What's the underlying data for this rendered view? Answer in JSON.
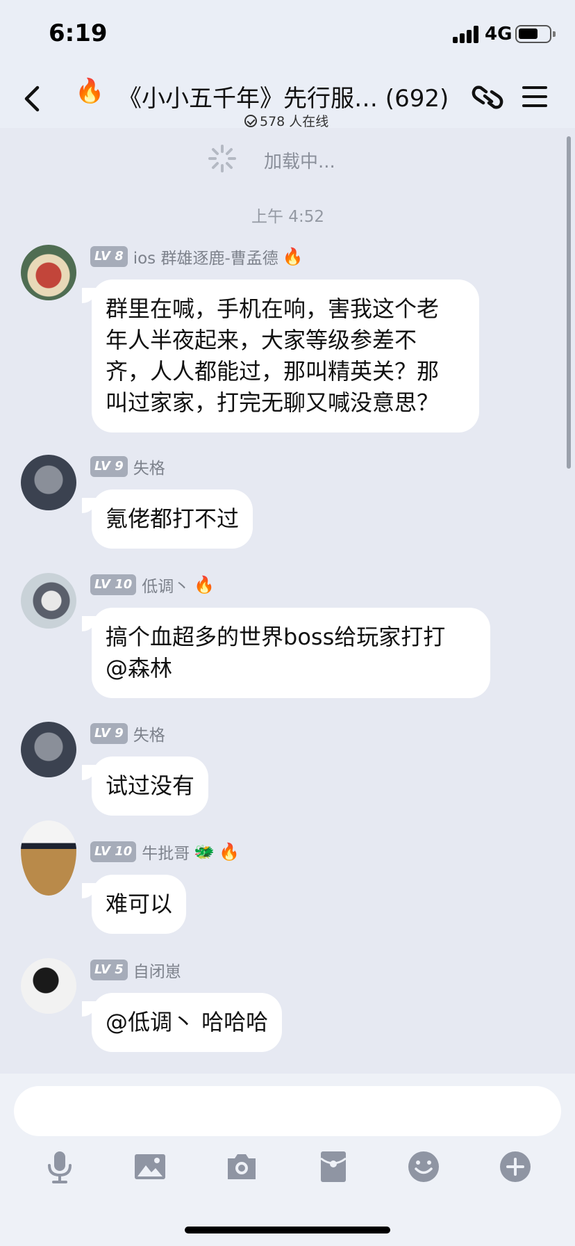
{
  "status_bar": {
    "time": "6:19",
    "network": "4G"
  },
  "header": {
    "title": "《小小五千年》先行服… (692)",
    "online": "578 人在线"
  },
  "chat": {
    "loading_text": "加载中...",
    "timestamp": "上午 4:52",
    "messages": [
      {
        "level": "LV 8",
        "name": "ios 群雄逐鹿-曹孟德",
        "badges": [
          "🔥"
        ],
        "lines": [
          "群里在喊，手机在响，害我这个老",
          "年人半夜起来，大家等级参差不",
          "齐，人人都能过，那叫精英关？那",
          "叫过家家，打完无聊又喊没意思？"
        ]
      },
      {
        "level": "LV 9",
        "name": "失格",
        "badges": [],
        "lines": [
          "氪佬都打不过"
        ]
      },
      {
        "level": "LV 10",
        "name": "低调丶",
        "badges": [
          "🔥"
        ],
        "lines": [
          "搞个血超多的世界boss给玩家打打",
          "@森林"
        ]
      },
      {
        "level": "LV 9",
        "name": "失格",
        "badges": [],
        "lines": [
          "试过没有"
        ]
      },
      {
        "level": "LV 10",
        "name": "牛批哥",
        "badges": [
          "🐲",
          "🔥"
        ],
        "lines": [
          "难可以"
        ]
      },
      {
        "level": "LV 5",
        "name": "自闭崽",
        "badges": [],
        "lines": [
          "@低调丶 哈哈哈"
        ]
      }
    ]
  },
  "toolbar": {
    "icons": [
      "microphone-icon",
      "image-icon",
      "camera-icon",
      "red-packet-icon",
      "emoji-icon",
      "plus-icon"
    ]
  },
  "colors": {
    "background": "#e6e9f2",
    "bubble": "#ffffff",
    "level_badge": "#a6acb9",
    "username": "#7d828c"
  }
}
